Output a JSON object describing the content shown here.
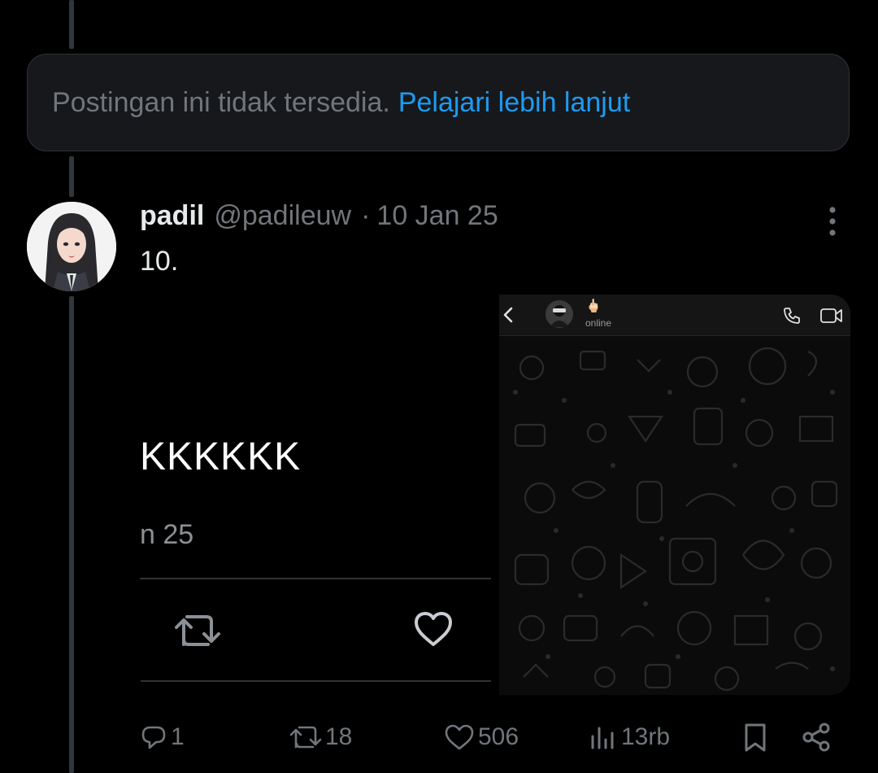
{
  "unavailable_notice": {
    "text": "Postingan ini tidak tersedia.",
    "link": "Pelajari lebih lanjut"
  },
  "post": {
    "display_name": "padil",
    "handle": "@padileuw",
    "separator": "·",
    "date": "10 Jan 25",
    "text": "10."
  },
  "quoted_screenshot": {
    "text": "KKKKKK",
    "date": "n 25"
  },
  "chat_screenshot": {
    "status": "online",
    "emoji": "🖕🏻"
  },
  "action_bar": {
    "replies": "1",
    "reposts": "18",
    "likes": "506",
    "views": "13rb"
  },
  "colors": {
    "background": "#000000",
    "accent": "#1d9bf0",
    "muted": "#71767b",
    "card": "#16181c",
    "border": "#2f3336"
  }
}
